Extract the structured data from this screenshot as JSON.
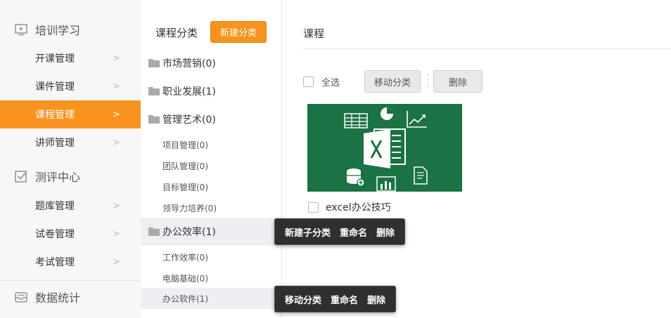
{
  "nav": {
    "sections": [
      {
        "label": "培训学习",
        "icon": "play-screen-icon"
      },
      {
        "label": "测评中心",
        "icon": "checkbox-icon"
      },
      {
        "label": "数据统计",
        "icon": "inbox-tray-icon"
      }
    ],
    "training_items": [
      "开课管理",
      "课件管理",
      "课程管理",
      "讲师管理"
    ],
    "exam_items": [
      "题库管理",
      "试卷管理",
      "考试管理"
    ],
    "active_item": "课程管理",
    "chevron": ">"
  },
  "category_panel": {
    "title": "课程分类",
    "new_button": "新建分类",
    "rows": [
      {
        "label": "市场营销(0)",
        "level": 1
      },
      {
        "label": "职业发展(1)",
        "level": 1
      },
      {
        "label": "管理艺术(0)",
        "level": 1
      },
      {
        "label": "项目管理(0)",
        "level": 2
      },
      {
        "label": "团队管理(0)",
        "level": 2
      },
      {
        "label": "目标管理(0)",
        "level": 2
      },
      {
        "label": "领导力培养(0)",
        "level": 2
      },
      {
        "label": "办公效率(1)",
        "level": 1
      },
      {
        "label": "工作效率(0)",
        "level": 2
      },
      {
        "label": "电脑基础(0)",
        "level": 2
      },
      {
        "label": "办公软件(1)",
        "level": 2
      }
    ]
  },
  "main": {
    "title": "课程",
    "select_all": "全选",
    "move_button": "移动分类",
    "delete_button": "删除",
    "course": {
      "name": "excel办公技巧",
      "thumbnail_icon": "excel-icon"
    }
  },
  "tooltip_category": {
    "new_sub": "新建子分类",
    "rename": "重命名",
    "delete": "删除"
  },
  "tooltip_subcategory": {
    "move": "移动分类",
    "rename": "重命名",
    "delete": "删除"
  },
  "colors": {
    "accent": "#f7931e",
    "excel_green": "#1b7244",
    "tooltip_bg": "#2f2f2f"
  }
}
